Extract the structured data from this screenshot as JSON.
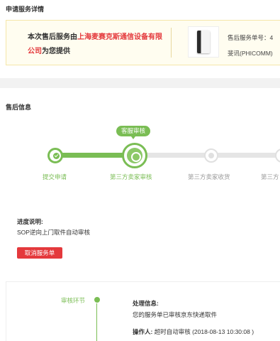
{
  "header": {
    "title": "申请服务详情"
  },
  "provider": {
    "text_prefix": "本次售后服务由",
    "company": "上海麦赛克斯通信设备有限公司",
    "text_suffix": "为您提供"
  },
  "product": {
    "service_no": "售后服务单号：4",
    "name": "斐讯(PHICOMM)"
  },
  "aftersale": {
    "title": "售后信息"
  },
  "progress": {
    "current_badge": "客服审核",
    "steps": [
      {
        "label": "提交申请",
        "state": "done"
      },
      {
        "label": "第三方卖家审核",
        "state": "current"
      },
      {
        "label": "第三方卖家收货",
        "state": "todo"
      },
      {
        "label": "第三方",
        "state": "todo"
      }
    ],
    "colors": {
      "done": "#7abd54",
      "todo": "#e0e0e0"
    }
  },
  "note": {
    "label": "进度说明:",
    "text": "SOP逆向上门取件自动审核"
  },
  "actions": {
    "cancel_label": "取消服务单"
  },
  "audit": {
    "stage": "审核环节",
    "info_label": "处理信息:",
    "info_text": "您的服务单已审核京东快递取件",
    "operator_label": "操作人:",
    "operator_value": "超时自动审核 (2018-08-13 10:30:08 )"
  },
  "colors": {
    "accent_red": "#e4393c",
    "accent_green": "#7abd54"
  }
}
